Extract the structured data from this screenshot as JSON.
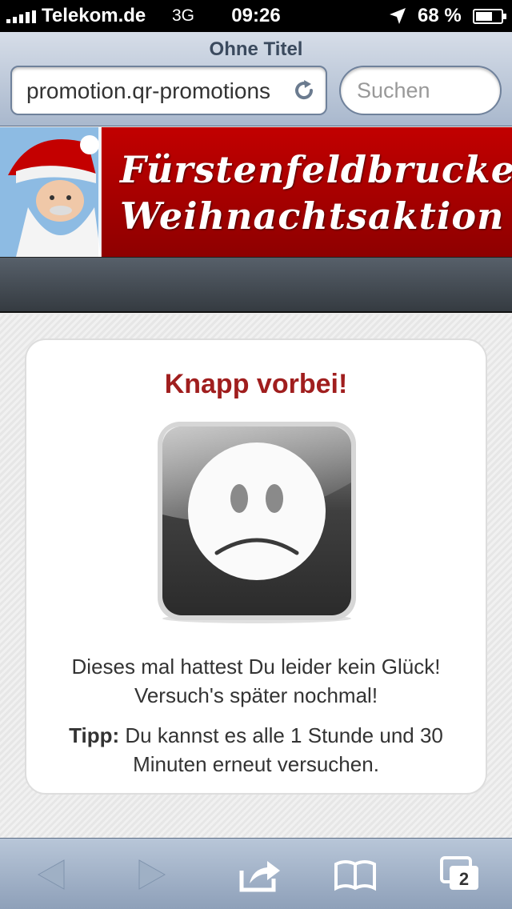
{
  "status_bar": {
    "carrier": "Telekom.de",
    "network": "3G",
    "time": "09:26",
    "battery_percent": "68 %",
    "battery_level": 0.68
  },
  "browser": {
    "page_title": "Ohne Titel",
    "url": "promotion.qr-promotions",
    "search_placeholder": "Suchen",
    "tab_count": "2"
  },
  "banner": {
    "line1": "Fürstenfeldbrucker",
    "line2": "Weihnachtsaktion",
    "colors": {
      "background": "#b40000",
      "text": "#ffffff"
    }
  },
  "result": {
    "heading": "Knapp vorbei!",
    "message": "Dieses mal hattest Du leider kein Glück! Versuch's später nochmal!",
    "tip_label": "Tipp:",
    "tip_text": "Du kannst es alle 1 Stunde und 30 Minuten erneut versuchen.",
    "icon": "sad-face-icon",
    "colors": {
      "heading": "#a01e1e"
    }
  },
  "icons": {
    "back": "back-arrow-icon",
    "forward": "forward-arrow-icon",
    "share": "share-icon",
    "bookmarks": "bookmarks-icon",
    "tabs": "tabs-icon",
    "reload": "reload-icon",
    "location": "location-arrow-icon"
  }
}
